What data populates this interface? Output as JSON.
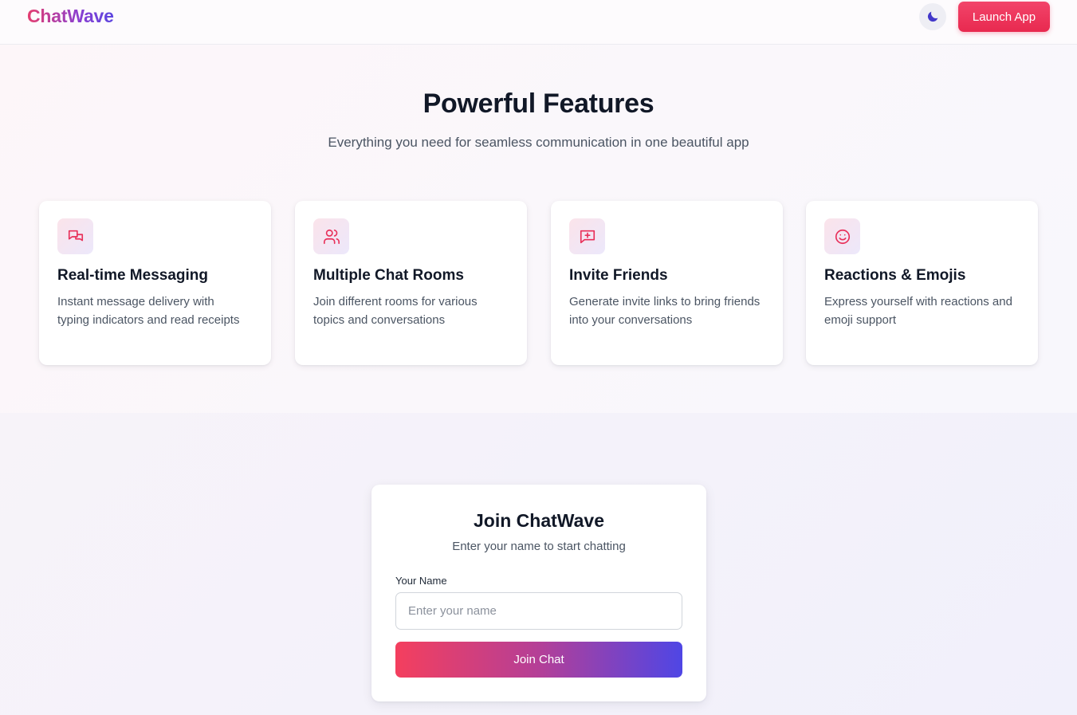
{
  "header": {
    "logo": "ChatWave",
    "theme_toggle_icon": "moon-icon",
    "launch_label": "Launch App"
  },
  "features": {
    "title": "Powerful Features",
    "subtitle": "Everything you need for seamless communication in one beautiful app",
    "cards": [
      {
        "icon": "chat-bubbles-icon",
        "title": "Real-time Messaging",
        "description": "Instant message delivery with typing indicators and read receipts"
      },
      {
        "icon": "users-icon",
        "title": "Multiple Chat Rooms",
        "description": "Join different rooms for various topics and conversations"
      },
      {
        "icon": "message-plus-icon",
        "title": "Invite Friends",
        "description": "Generate invite links to bring friends into your conversations"
      },
      {
        "icon": "smile-icon",
        "title": "Reactions & Emojis",
        "description": "Express yourself with reactions and emoji support"
      }
    ]
  },
  "join": {
    "title": "Join ChatWave",
    "subtitle": "Enter your name to start chatting",
    "name_label": "Your Name",
    "name_value": "",
    "name_placeholder": "Enter your name",
    "button_label": "Join Chat"
  },
  "colors": {
    "accent_pink": "#e8294f",
    "accent_indigo": "#4f46e5",
    "icon_stroke": "#e8305a",
    "moon": "#4338ca"
  }
}
